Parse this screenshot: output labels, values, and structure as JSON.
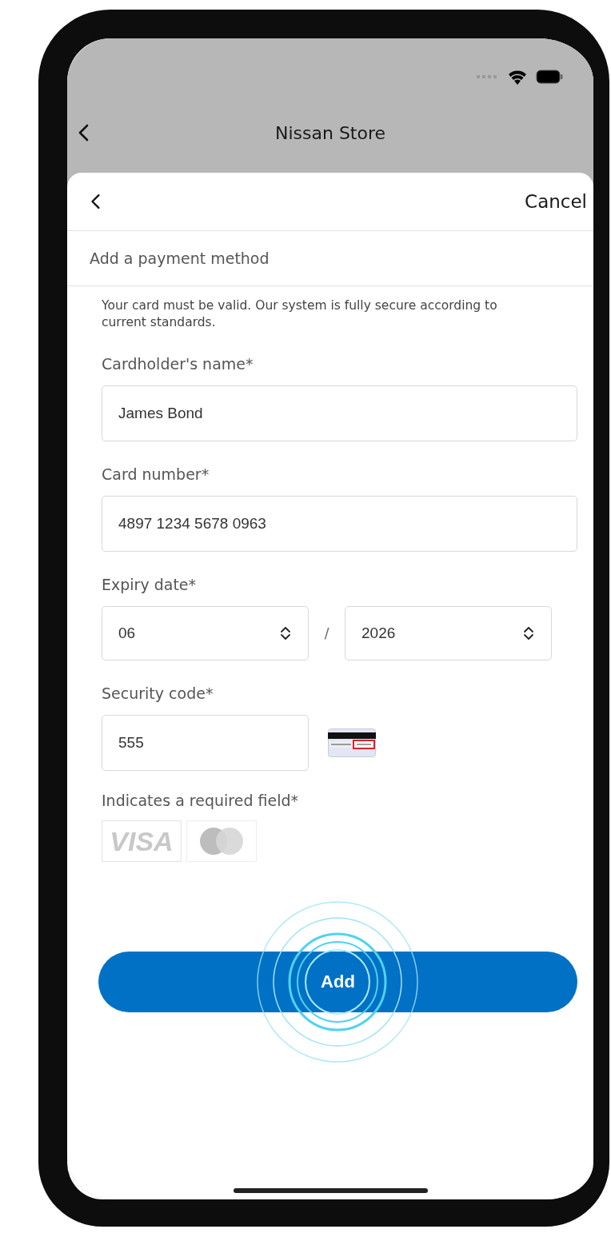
{
  "nav_bar": {
    "title": "Nissan Store"
  },
  "sheet": {
    "cancel": "Cancel",
    "heading": "Add a payment method",
    "description": "Your card must be valid. Our system is fully secure according to current standards.",
    "fields": [
      {
        "kind": "text",
        "label": "Cardholder's name*",
        "value": "James Bond"
      },
      {
        "kind": "text",
        "label": "Card number*",
        "value": "4897 1234 5678 0963"
      },
      {
        "kind": "expiry",
        "label": "Expiry date*",
        "month": "06",
        "separator": "/",
        "year": "2026"
      },
      {
        "kind": "cvv",
        "label": "Security code*",
        "value": "555"
      }
    ],
    "required_note": "Indicates a required field*",
    "visa_logo": "VISA",
    "submit": "Add"
  }
}
